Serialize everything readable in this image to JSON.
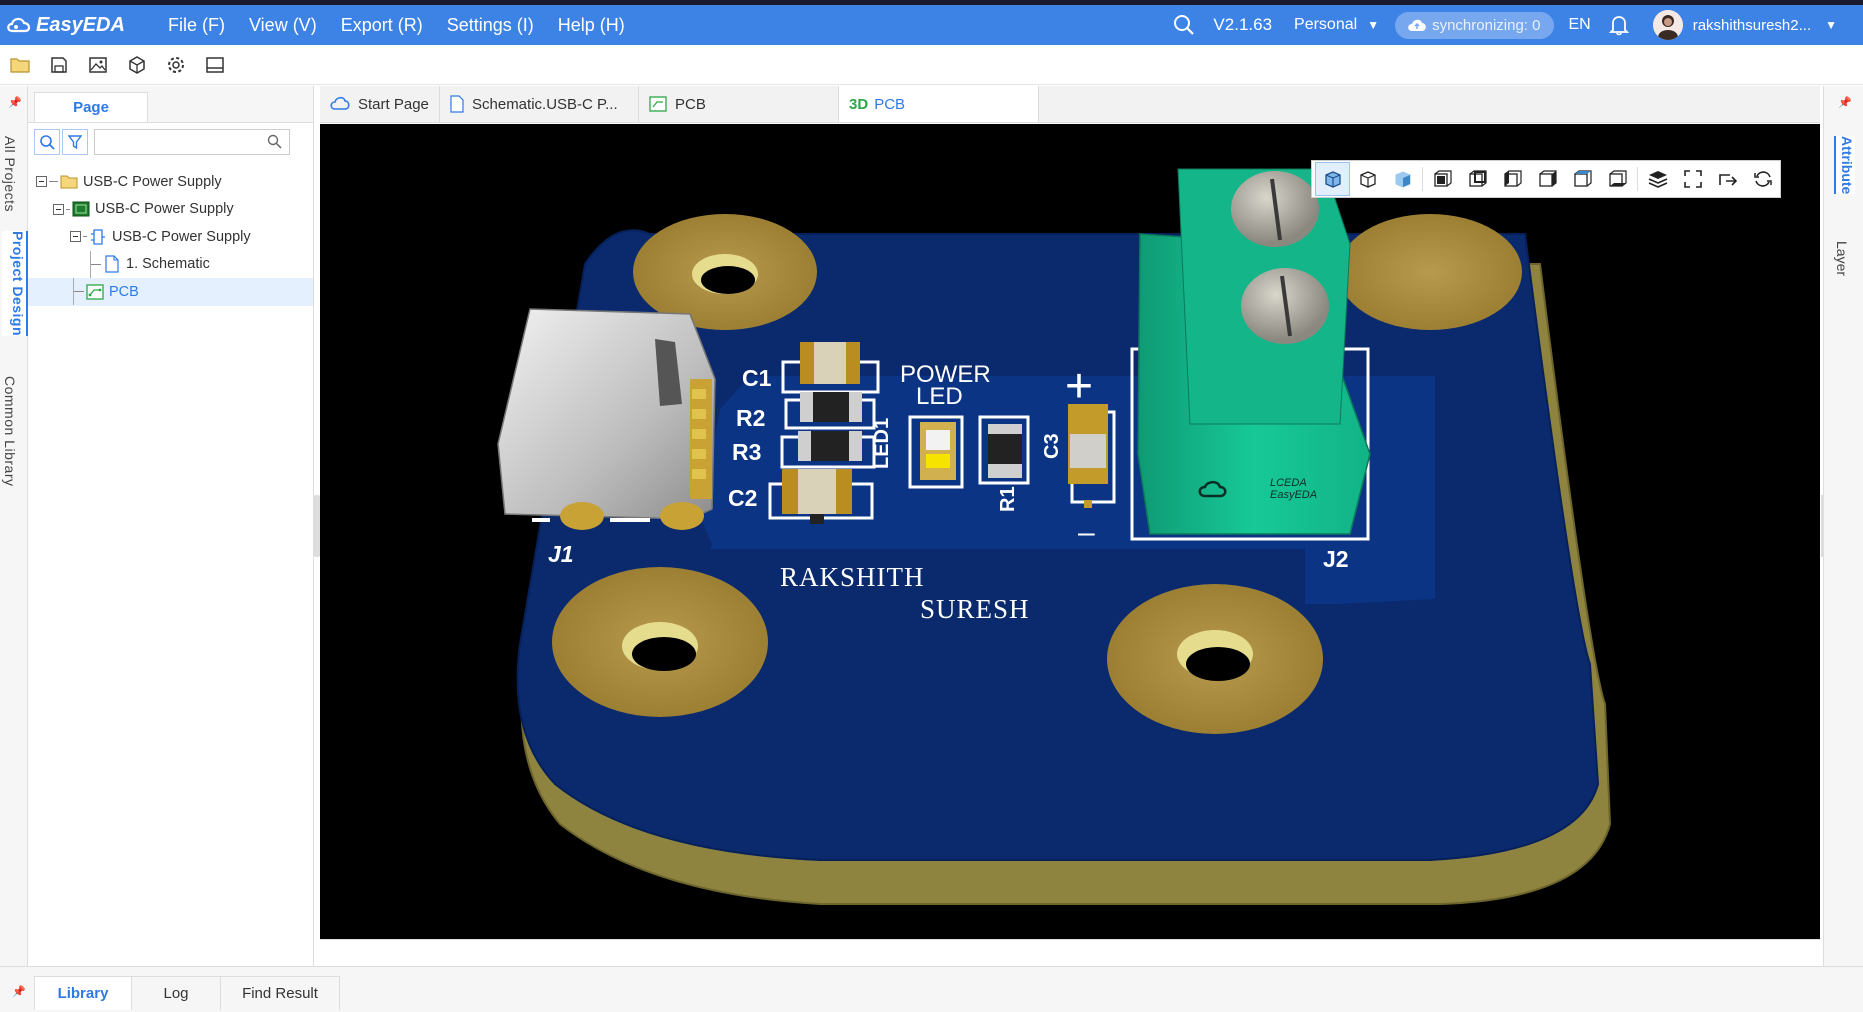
{
  "app": {
    "logo_text": "EasyEDA",
    "menus": [
      "File (F)",
      "View (V)",
      "Export (R)",
      "Settings (I)",
      "Help (H)"
    ],
    "version": "V2.1.63",
    "team": "Personal",
    "sync_status": "synchronizing: 0",
    "language": "EN",
    "username": "rakshithsuresh2...",
    "accent": "#3d83e6"
  },
  "toolbar": {
    "icons": [
      "folder-icon",
      "save-icon",
      "image-icon",
      "package-icon",
      "gear-icon",
      "panel-icon"
    ]
  },
  "left_strip": {
    "tabs": [
      "All Projects",
      "Project Design",
      "Common Library"
    ],
    "active": "Project Design"
  },
  "left_panel": {
    "tab": "Page",
    "search": {
      "value": "",
      "placeholder": ""
    },
    "tree": [
      {
        "label": "USB-C Power Supply",
        "icon": "folder-icon",
        "level": 0
      },
      {
        "label": "USB-C Power Supply",
        "icon": "board-icon",
        "level": 1
      },
      {
        "label": "USB-C Power Supply",
        "icon": "schematic-group-icon",
        "level": 2
      },
      {
        "label": "1. Schematic",
        "icon": "page-icon",
        "level": 3
      },
      {
        "label": "PCB",
        "icon": "pcb-icon",
        "level": 2,
        "selected": true
      }
    ]
  },
  "doc_tabs": [
    {
      "label": "Start Page",
      "icon": "cloud-icon"
    },
    {
      "label": "Schematic.USB-C P...",
      "icon": "document-icon"
    },
    {
      "label": "PCB",
      "icon": "pcb-icon"
    },
    {
      "prefix": "3D",
      "label": "PCB",
      "active": true
    }
  ],
  "viewport_3d": {
    "board_text": [
      "RAKSHITH",
      "SURESH"
    ],
    "silkscreen": [
      "C1",
      "R2",
      "R3",
      "C2",
      "POWER",
      "LED",
      "LED1",
      "C3",
      "R1",
      "J1",
      "J2",
      "+",
      "–"
    ],
    "connector_marking": [
      "LCEDA",
      "EasyEDA"
    ],
    "view_buttons": [
      "3d-view-icon",
      "wireframe-view-icon",
      "solid-view-icon",
      "front-view-icon",
      "back-view-icon",
      "left-view-icon",
      "right-view-icon",
      "top-view-icon",
      "bottom-view-icon",
      "layers-icon",
      "fullscreen-icon",
      "export-icon",
      "reset-view-icon"
    ]
  },
  "right_strip": {
    "tabs": [
      "Attribute",
      "Layer"
    ],
    "active": "Attribute"
  },
  "bottom_tabs": [
    {
      "label": "Library",
      "active": true
    },
    {
      "label": "Log"
    },
    {
      "label": "Find Result"
    }
  ]
}
